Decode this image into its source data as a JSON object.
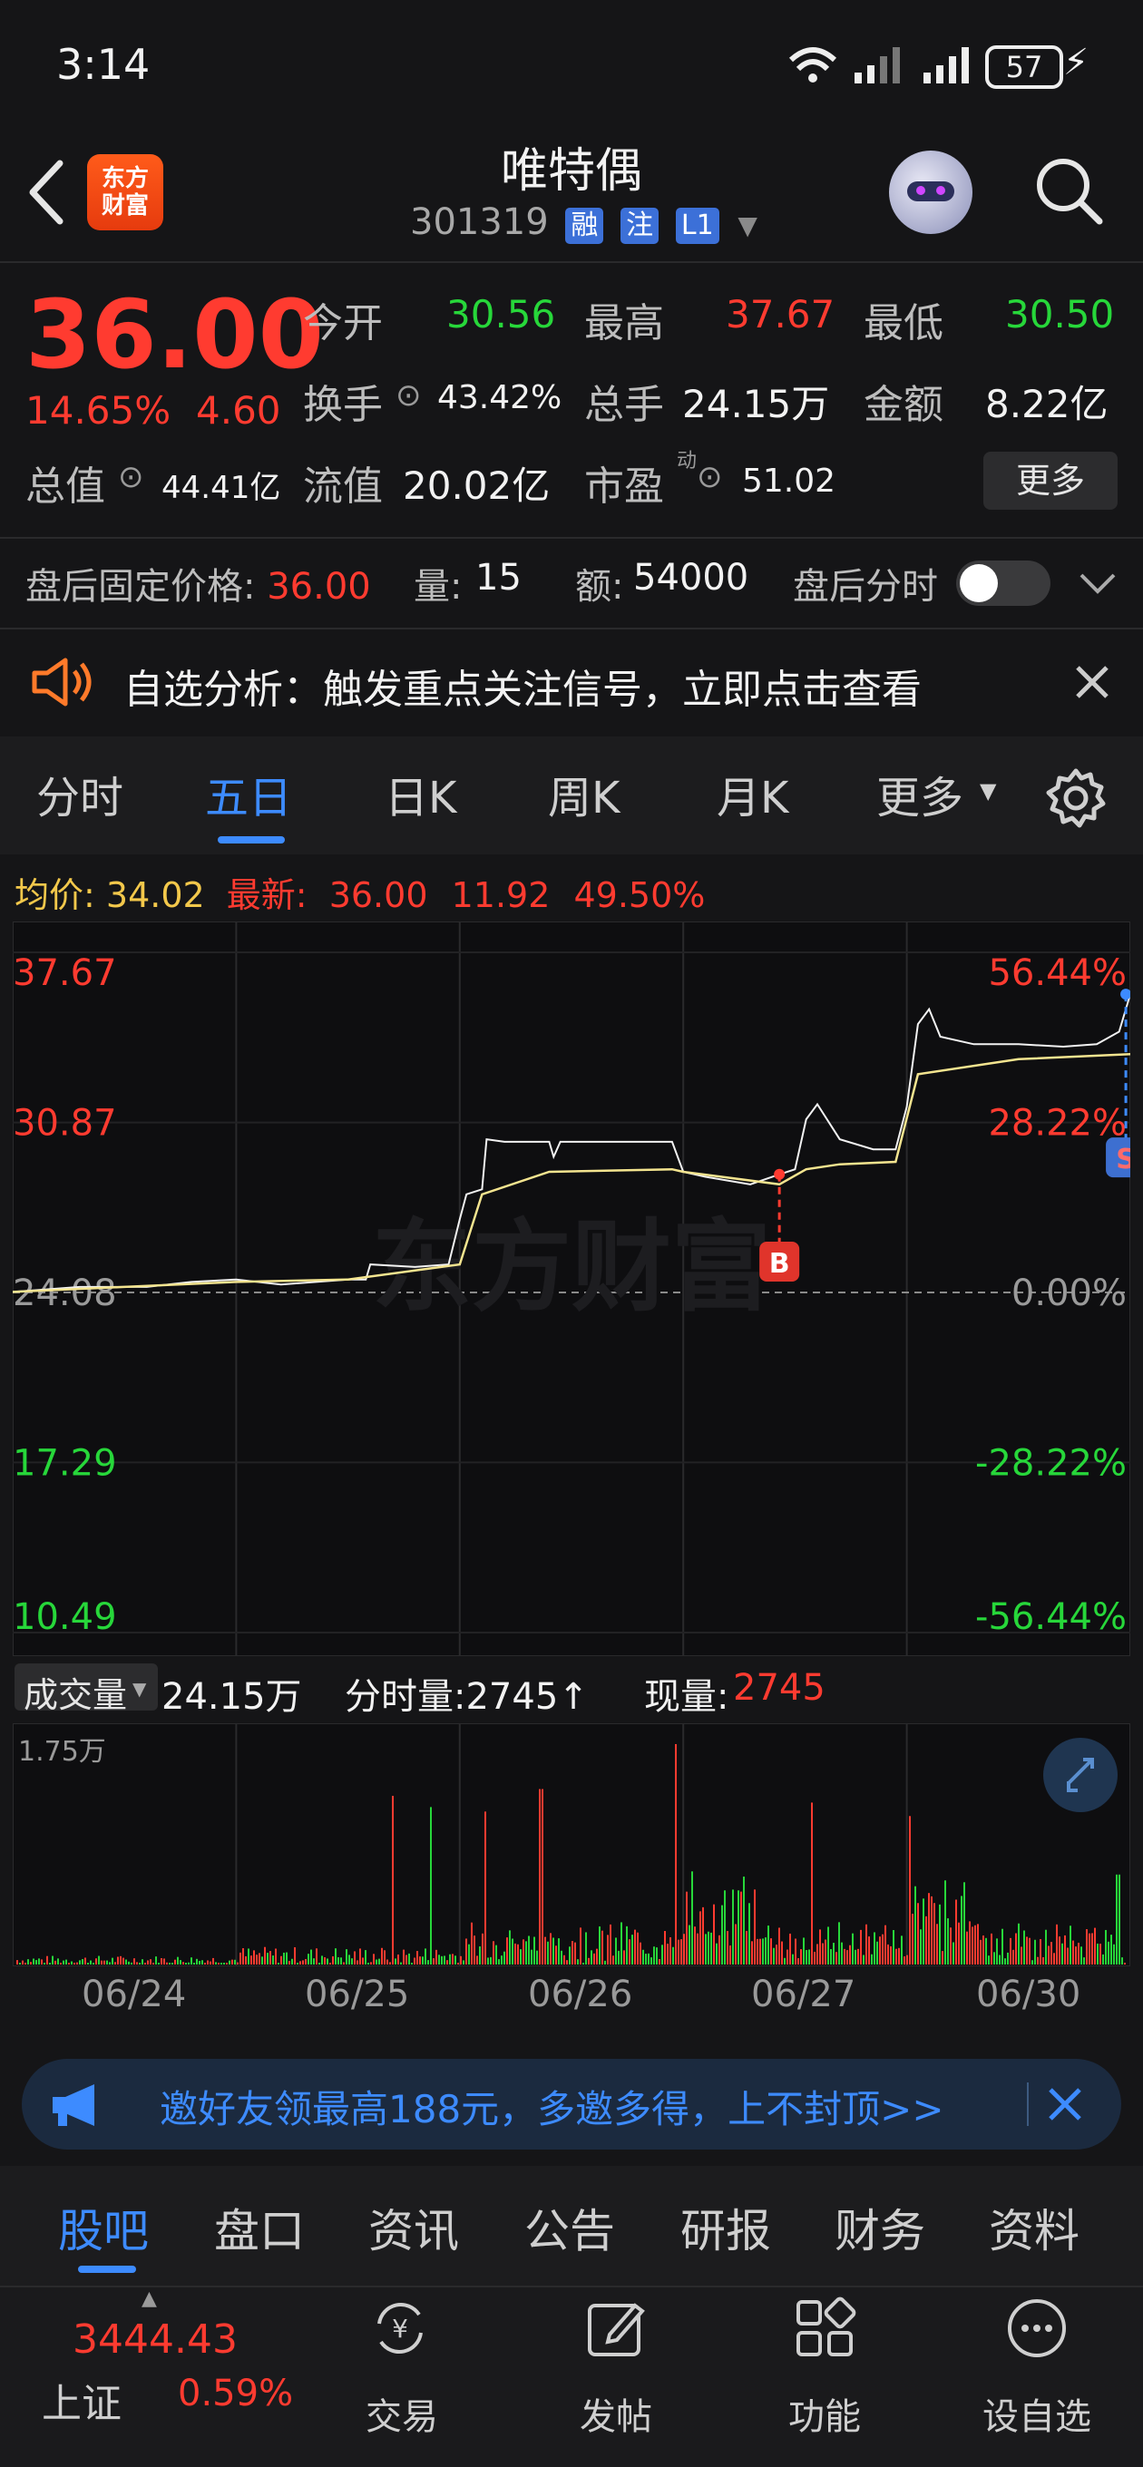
{
  "status_bar": {
    "time": "3:14",
    "battery": "57"
  },
  "header": {
    "logo_text_line1": "东方",
    "logo_text_line2": "财富",
    "title": "唯特偶",
    "code": "301319",
    "badges": [
      "融",
      "注",
      "L1"
    ]
  },
  "quote": {
    "price": "36.00",
    "change_pct": "14.65%",
    "change": "4.60",
    "open_label": "今开",
    "open": "30.56",
    "high_label": "最高",
    "high": "37.67",
    "low_label": "最低",
    "low": "30.50",
    "turnover_label": "换手",
    "turnover": "43.42%",
    "volume_label": "总手",
    "volume": "24.15万",
    "amount_label": "金额",
    "amount": "8.22亿",
    "mktcap_label": "总值",
    "mktcap": "44.41亿",
    "float_label": "流值",
    "float": "20.02亿",
    "pe_label": "市盈",
    "pe_sup": "动",
    "pe": "51.02",
    "more_button": "更多"
  },
  "after_hours": {
    "price_label": "盘后固定价格:",
    "price": "36.00",
    "vol_label": "量:",
    "vol": "15",
    "amt_label": "额:",
    "amt": "54000",
    "toggle_label": "盘后分时"
  },
  "notice": {
    "text": "自选分析：触发重点关注信号，立即点击查看"
  },
  "chart_tabs": {
    "items": [
      "分时",
      "五日",
      "日K",
      "周K",
      "月K",
      "更多"
    ],
    "active": "五日"
  },
  "chart_info": {
    "avg_label": "均价:",
    "avg": "34.02",
    "latest_label": "最新:",
    "latest": "36.00",
    "change": "11.92",
    "change_pct": "49.50%"
  },
  "volume_info": {
    "selector": "成交量",
    "total": "24.15万",
    "tick_vol": "分时量:2745↑",
    "now_label": "现量:",
    "now": "2745",
    "ymax_label": "1.75万"
  },
  "watermark": "东方财富",
  "markers": {
    "buy": "B",
    "sell": "S"
  },
  "promo": {
    "text": "邀好友领最高188元，多邀多得，上不封顶>>"
  },
  "bottom_tabs": {
    "items": [
      "股吧",
      "盘口",
      "资讯",
      "公告",
      "研报",
      "财务",
      "资料"
    ],
    "active": "股吧"
  },
  "bottom_nav": {
    "index_value": "3444.43",
    "index_name": "上证",
    "index_change": "0.59%",
    "items": [
      "交易",
      "发帖",
      "功能",
      "设自选"
    ]
  },
  "colors": {
    "up": "#ff3b30",
    "down": "#27d73a",
    "accent": "#3d8bff",
    "avg_line": "#f3e48f",
    "price_line": "#f2f2f2"
  },
  "chart_data": {
    "type": "line",
    "x_categories": [
      "06/24",
      "06/25",
      "06/26",
      "06/27",
      "06/30"
    ],
    "y_left_ticks": [
      "37.67",
      "30.87",
      "24.08",
      "17.29",
      "10.49"
    ],
    "y_right_ticks": [
      "56.44%",
      "28.22%",
      "0.00%",
      "-28.22%",
      "-56.44%"
    ],
    "ylim": [
      10.49,
      37.67
    ],
    "base": 24.08,
    "series": [
      {
        "points": [
          [
            0,
            24.1
          ],
          [
            0.3,
            24.3
          ],
          [
            0.6,
            24.3
          ],
          [
            0.8,
            24.5
          ],
          [
            1.0,
            24.6
          ],
          [
            1.2,
            24.4
          ],
          [
            1.5,
            24.6
          ],
          [
            1.58,
            24.6
          ],
          [
            1.6,
            25.2
          ],
          [
            1.8,
            25.1
          ],
          [
            1.95,
            25.2
          ],
          [
            2.0,
            27.0
          ],
          [
            2.03,
            28.0
          ],
          [
            2.1,
            28.2
          ],
          [
            2.12,
            30.2
          ],
          [
            2.2,
            30.1
          ],
          [
            2.4,
            30.1
          ],
          [
            2.42,
            29.5
          ],
          [
            2.45,
            30.1
          ],
          [
            2.6,
            30.1
          ],
          [
            2.7,
            30.1
          ],
          [
            2.95,
            30.1
          ],
          [
            3.0,
            28.9
          ],
          [
            3.1,
            28.7
          ],
          [
            3.3,
            28.4
          ],
          [
            3.43,
            28.8
          ],
          [
            3.5,
            29.0
          ],
          [
            3.55,
            31.0
          ],
          [
            3.6,
            31.6
          ],
          [
            3.7,
            30.2
          ],
          [
            3.85,
            29.8
          ],
          [
            3.95,
            29.8
          ],
          [
            4.0,
            31.5
          ],
          [
            4.05,
            34.8
          ],
          [
            4.1,
            35.4
          ],
          [
            4.15,
            34.3
          ],
          [
            4.3,
            34.0
          ],
          [
            4.5,
            34.0
          ],
          [
            4.7,
            33.9
          ],
          [
            4.85,
            34.0
          ],
          [
            4.95,
            34.5
          ],
          [
            5.0,
            36.0
          ]
        ]
      },
      {
        "points": [
          [
            0,
            24.1
          ],
          [
            0.5,
            24.3
          ],
          [
            1.0,
            24.5
          ],
          [
            1.5,
            24.6
          ],
          [
            2.0,
            25.2
          ],
          [
            2.1,
            28.0
          ],
          [
            2.4,
            28.9
          ],
          [
            2.95,
            29.0
          ],
          [
            3.0,
            28.9
          ],
          [
            3.43,
            28.4
          ],
          [
            3.55,
            29.0
          ],
          [
            3.7,
            29.2
          ],
          [
            3.95,
            29.3
          ],
          [
            4.05,
            32.8
          ],
          [
            4.5,
            33.4
          ],
          [
            5.0,
            33.6
          ]
        ]
      }
    ],
    "volume_ylim": [
      0,
      17500
    ],
    "volume_ylabel": "1.75万"
  }
}
